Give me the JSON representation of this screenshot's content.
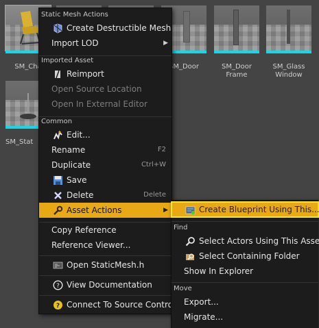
{
  "assets": [
    {
      "name": "SM_Chair",
      "display": "SM_Cha",
      "icon": "chair-thumbnail-icon"
    },
    {
      "name": "",
      "display": "",
      "icon": "mesh-thumbnail-icon"
    },
    {
      "name": "",
      "display": "",
      "icon": "mesh-thumbnail-icon"
    },
    {
      "name": "SM_Door",
      "display": "SM_Door",
      "icon": "door-thumbnail-icon"
    },
    {
      "name": "SM_Door Frame",
      "display": "SM_Door Frame",
      "icon": "door-frame-thumbnail-icon"
    },
    {
      "name": "SM_Glass Window",
      "display": "SM_Glass Window",
      "icon": "glass-window-thumbnail-icon"
    },
    {
      "name": "SM_Stat",
      "display": "SM_Stat",
      "icon": "lamp-thumbnail-icon"
    }
  ],
  "context_menu": {
    "sections": {
      "static_mesh_actions": "Static Mesh Actions",
      "imported_asset": "Imported Asset",
      "common": "Common"
    },
    "items": {
      "create_destructible_mesh": "Create Destructible Mesh",
      "import_lod": "Import LOD",
      "reimport": "Reimport",
      "open_source_location": "Open Source Location",
      "open_in_external_editor": "Open In External Editor",
      "edit": "Edit...",
      "rename": "Rename",
      "rename_shortcut": "F2",
      "duplicate": "Duplicate",
      "duplicate_shortcut": "Ctrl+W",
      "save": "Save",
      "delete": "Delete",
      "delete_shortcut": "Delete",
      "asset_actions": "Asset Actions",
      "copy_reference": "Copy Reference",
      "reference_viewer": "Reference Viewer...",
      "open_staticmesh_h": "Open StaticMesh.h",
      "view_documentation": "View Documentation",
      "connect_to_source_control": "Connect To Source Control"
    }
  },
  "submenu": {
    "sections": {
      "find": "Find",
      "move": "Move"
    },
    "items": {
      "create_blueprint": "Create Blueprint Using This...",
      "select_actors": "Select Actors Using This Asset",
      "select_folder": "Select Containing Folder",
      "show_in_explorer": "Show In Explorer",
      "export": "Export...",
      "migrate": "Migrate..."
    }
  },
  "colors": {
    "highlight": "#e8a914",
    "focus_outline": "#f4e234",
    "asset_bar": "#12d8e8",
    "menu_bg": "#1c1c1c"
  }
}
